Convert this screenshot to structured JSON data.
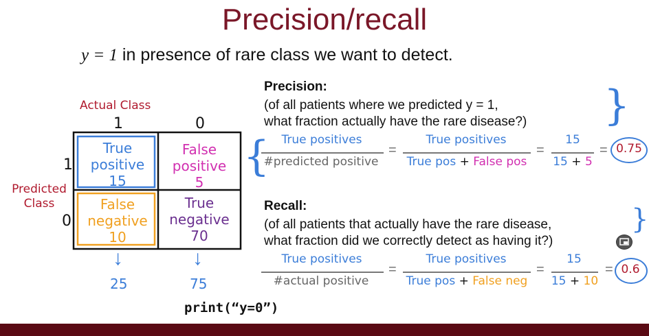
{
  "slide": {
    "title": "Precision/recall",
    "subtitle_math": "y = 1",
    "subtitle_text": " in presence of rare class we want to detect."
  },
  "matrix": {
    "actual_label": "Actual Class",
    "actual_col_1": "1",
    "actual_col_0": "0",
    "predicted_label_line1": "Predicted",
    "predicted_label_line2": "Class",
    "pred_row_1": "1",
    "pred_row_0": "0",
    "tp_line1": "True",
    "tp_line2": "positive",
    "tp_count": "15",
    "fp_line1": "False",
    "fp_line2": "positive",
    "fp_count": "5",
    "fn_line1": "False",
    "fn_line2": "negative",
    "fn_count": "10",
    "tn_line1": "True",
    "tn_line2": "negative",
    "tn_count": "70",
    "arrow": "↓",
    "col1_total": "25",
    "col0_total": "75"
  },
  "precision": {
    "heading": "Precision:",
    "line1": "(of all patients where we predicted y = 1,",
    "line2": "what fraction actually have the rare disease?)",
    "f1_num": "True positives",
    "f1_den": "#predicted positive",
    "f2_num": "True positives",
    "f2_den_a": "True pos",
    "f2_den_plus": " + ",
    "f2_den_b": "False pos",
    "f3_num": "15",
    "f3_den_a": "15",
    "f3_den_plus": " + ",
    "f3_den_b": "5",
    "equals": "=",
    "result": "0.75"
  },
  "recall": {
    "heading": "Recall:",
    "line1": "(of all patients that actually have the rare disease,",
    "line2": "what fraction did we correctly detect as having it?)",
    "f1_num": "True positives",
    "f1_den": "#actual positive",
    "f2_num": "True positives",
    "f2_den_a": "True pos",
    "f2_den_plus": " + ",
    "f2_den_b": "False neg",
    "f3_num": "15",
    "f3_den_a": "15",
    "f3_den_plus": " + ",
    "f3_den_b": "10",
    "equals": "=",
    "result": "0.6"
  },
  "code_note": "print(“y=0”)"
}
